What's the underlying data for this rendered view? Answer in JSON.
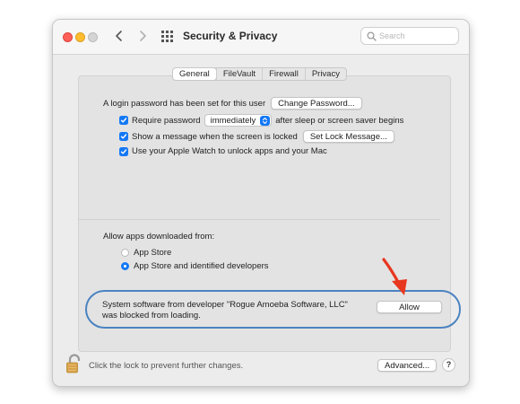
{
  "window": {
    "title": "Security & Privacy",
    "search_placeholder": "Search"
  },
  "tabs": [
    {
      "label": "General",
      "active": true
    },
    {
      "label": "FileVault",
      "active": false
    },
    {
      "label": "Firewall",
      "active": false
    },
    {
      "label": "Privacy",
      "active": false
    }
  ],
  "general": {
    "login_text": "A login password has been set for this user",
    "change_password_button": "Change Password...",
    "require_password": {
      "label": "Require password",
      "checked": true,
      "select_value": "immediately",
      "suffix": "after sleep or screen saver begins"
    },
    "show_message": {
      "label": "Show a message when the screen is locked",
      "checked": true,
      "button": "Set Lock Message..."
    },
    "apple_watch": {
      "label": "Use your Apple Watch to unlock apps and your Mac",
      "checked": true
    }
  },
  "allow_apps": {
    "heading": "Allow apps downloaded from:",
    "options": [
      {
        "label": "App Store",
        "selected": false
      },
      {
        "label": "App Store and identified developers",
        "selected": true
      }
    ]
  },
  "blocked": {
    "message": "System software from developer \"Rogue Amoeba Software, LLC\" was blocked from loading.",
    "allow_button": "Allow"
  },
  "footer": {
    "lock_text": "Click the lock to prevent further changes.",
    "advanced_button": "Advanced...",
    "help_button": "?"
  },
  "colors": {
    "accent": "#1478f5",
    "annotation_oval": "#4a83c1",
    "annotation_arrow": "#e8371f"
  }
}
